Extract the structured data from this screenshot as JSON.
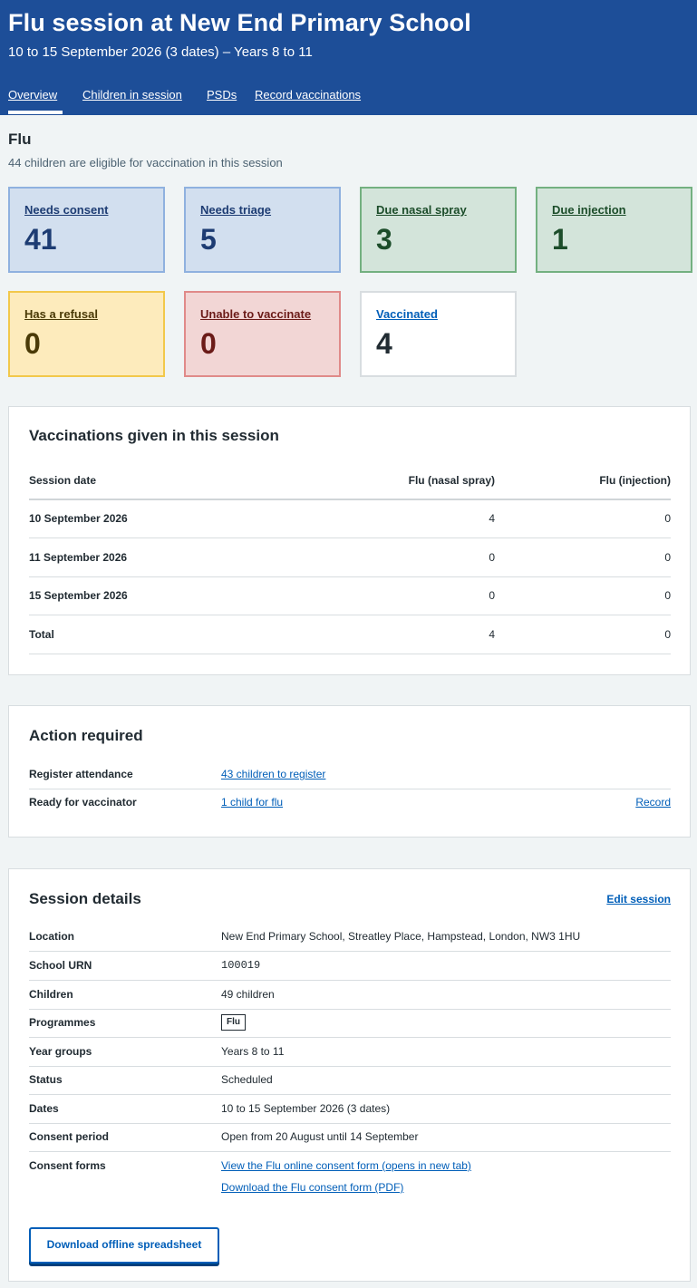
{
  "header": {
    "title": "Flu session at New End Primary School",
    "subtitle": "10 to 15 September 2026 (3 dates) – Years 8 to 11",
    "tabs": [
      "Overview",
      "Children in session",
      "PSDs",
      "Record vaccinations"
    ],
    "active_tab": "Overview"
  },
  "summary": {
    "title": "Flu",
    "subtitle": "44 children are eligible for vaccination in this session",
    "cards": [
      {
        "label": "Needs consent",
        "value": "41",
        "color": "#d2dfef"
      },
      {
        "label": "Needs triage",
        "value": "5",
        "color": "#d2dfef"
      },
      {
        "label": "Due nasal spray",
        "value": "3",
        "color": "#d3e4da"
      },
      {
        "label": "Due injection",
        "value": "1",
        "color": "#d3e4da"
      },
      {
        "label": "Has a refusal",
        "value": "0",
        "color": "#fdebbc"
      },
      {
        "label": "Unable to vaccinate",
        "value": "0",
        "color": "#f2d6d5"
      },
      {
        "label": "Vaccinated",
        "value": "4",
        "color": "#ffffff"
      }
    ]
  },
  "vaccinations": {
    "title": "Vaccinations given in this session",
    "headers": [
      "Session date",
      "Flu (nasal spray)",
      "Flu (injection)"
    ],
    "rows": [
      [
        "10 September 2026",
        "4",
        "0"
      ],
      [
        "11 September 2026",
        "0",
        "0"
      ],
      [
        "15 September 2026",
        "0",
        "0"
      ],
      [
        "Total",
        "4",
        "0"
      ]
    ]
  },
  "actions": {
    "title": "Action required",
    "rows": [
      {
        "key": "Register attendance",
        "link": "43 children to register",
        "action": ""
      },
      {
        "key": "Ready for vaccinator",
        "link": "1 child for flu",
        "action": "Record"
      }
    ]
  },
  "details": {
    "title": "Session details",
    "edit_link": "Edit session",
    "location_label": "Location",
    "location": "New End Primary School, Streatley Place, Hampstead, London, NW3 1HU",
    "urn_label": "School URN",
    "urn": "100019",
    "children_label": "Children",
    "children": "49 children",
    "programmes_label": "Programmes",
    "programme_tag": "Flu",
    "year_groups_label": "Year groups",
    "year_groups": "Years 8 to 11",
    "status_label": "Status",
    "status": "Scheduled",
    "dates_label": "Dates",
    "dates": "10 to 15 September 2026 (3 dates)",
    "consent_period_label": "Consent period",
    "consent_period": "Open from 20 August until 14 September",
    "consent_forms_label": "Consent forms",
    "consent_form_online": "View the Flu online consent form (opens in new tab)",
    "consent_form_pdf": "Download the Flu consent form (PDF)",
    "download_button": "Download offline spreadsheet"
  }
}
